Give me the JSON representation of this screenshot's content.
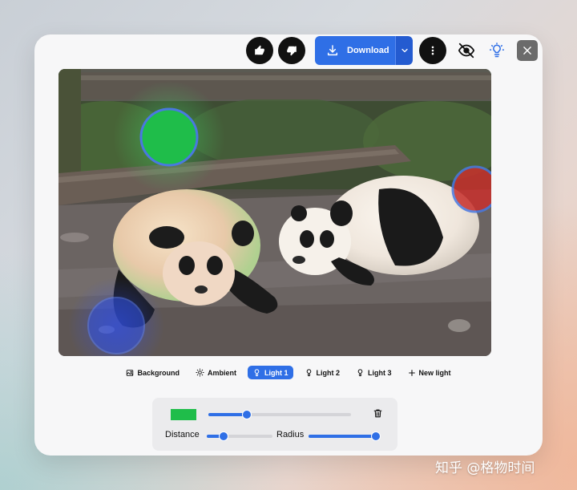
{
  "toolbar": {
    "like_icon": "thumbs-up-icon",
    "dislike_icon": "thumbs-down-icon",
    "download_label": "Download",
    "more_icon": "more-vertical-icon",
    "hide_icon": "eye-off-icon",
    "light_icon": "lightbulb-icon",
    "close_icon": "close-icon"
  },
  "light_tabs": [
    {
      "label": "Background",
      "icon": "image-icon",
      "active": false
    },
    {
      "label": "Ambient",
      "icon": "sun-icon",
      "active": false
    },
    {
      "label": "Light 1",
      "icon": "lightbulb-icon",
      "active": true
    },
    {
      "label": "Light 2",
      "icon": "lightbulb-icon",
      "active": false
    },
    {
      "label": "Light 3",
      "icon": "lightbulb-icon",
      "active": false
    },
    {
      "label": "New light",
      "icon": "plus-icon",
      "active": false
    }
  ],
  "controls": {
    "color": "#1fbd4a",
    "intensity_fraction": 0.27,
    "distance_label": "Distance",
    "distance_fraction": 0.25,
    "radius_label": "Radius",
    "radius_fraction": 1.0
  },
  "watermark": "知乎 @格物时间",
  "colors": {
    "accent": "#2f6fe6",
    "light_green": "#1fbd4a",
    "light_red": "#c8302c",
    "light_blue": "#2f4fd0"
  }
}
